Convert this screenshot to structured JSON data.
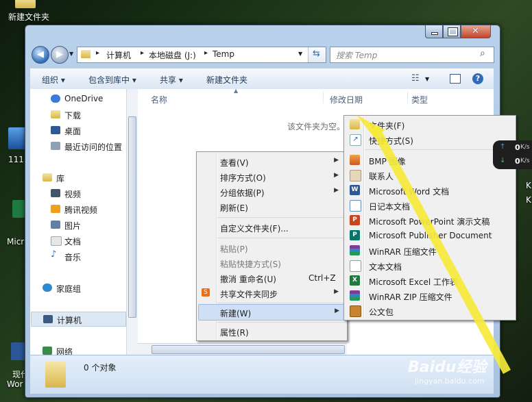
{
  "desktop": {
    "icons": [
      {
        "label": "新建文件夹"
      },
      {
        "label": "111"
      },
      {
        "label": "Micr"
      },
      {
        "label": "现代"
      },
      {
        "label": "Wor"
      }
    ],
    "right_stub": {
      "k1": "K",
      "k2": "K"
    }
  },
  "window": {
    "address": {
      "segments": [
        "计算机",
        "本地磁盘 (J:)",
        "Temp"
      ],
      "separator": "▸"
    },
    "search": {
      "placeholder": "搜索 Temp"
    },
    "toolbar": {
      "organize": "组织 ▾",
      "include_library": "包含到库中 ▾",
      "share": "共享 ▾",
      "new_folder": "新建文件夹"
    },
    "nav": {
      "items": [
        "OneDrive",
        "下载",
        "桌面",
        "最近访问的位置",
        "库",
        "视频",
        "腾讯视频",
        "图片",
        "文档",
        "音乐",
        "家庭组",
        "计算机",
        "网络"
      ]
    },
    "columns": {
      "name": "名称",
      "date": "修改日期",
      "type": "类型"
    },
    "empty_text": "该文件夹为空。",
    "details": {
      "count": "0 个对象"
    }
  },
  "context_menu": {
    "view": "查看(V)",
    "sort": "排序方式(O)",
    "group": "分组依据(P)",
    "refresh": "刷新(E)",
    "customize": "自定义文件夹(F)...",
    "paste": "粘贴(P)",
    "paste_shortcut": "粘贴快捷方式(S)",
    "undo": "撤消 重命名(U)",
    "undo_shortcut": "Ctrl+Z",
    "sync": "共享文件夹同步",
    "new": "新建(W)",
    "properties": "属性(R)"
  },
  "new_submenu": {
    "items": [
      {
        "label": "文件夹(F)",
        "icon": "folder-icon"
      },
      {
        "label": "快捷方式(S)",
        "icon": "shortcut-icon"
      },
      {
        "label": "BMP 图像",
        "icon": "bmp-icon"
      },
      {
        "label": "联系人",
        "icon": "contact-icon"
      },
      {
        "label": "Microsoft Word 文档",
        "icon": "word-icon"
      },
      {
        "label": "日记本文档",
        "icon": "journal-icon"
      },
      {
        "label": "Microsoft PowerPoint 演示文稿",
        "icon": "powerpoint-icon"
      },
      {
        "label": "Microsoft Publisher Document",
        "icon": "publisher-icon"
      },
      {
        "label": "WinRAR 压缩文件",
        "icon": "winrar-icon"
      },
      {
        "label": "文本文档",
        "icon": "text-icon"
      },
      {
        "label": "Microsoft Excel 工作表",
        "icon": "excel-icon"
      },
      {
        "label": "WinRAR ZIP 压缩文件",
        "icon": "winrar-zip-icon"
      },
      {
        "label": "公文包",
        "icon": "briefcase-icon"
      }
    ]
  },
  "speed_widget": {
    "up": "0",
    "up_unit": "K/s",
    "down": "0",
    "down_unit": "K/s"
  },
  "watermark": {
    "text": "Baidu经验",
    "url": "jingyan.baidu.com"
  },
  "colors": {
    "menu_hover": "#cfe0f6",
    "arrow": "#f5e93a",
    "accent": "#2f6cb5"
  }
}
